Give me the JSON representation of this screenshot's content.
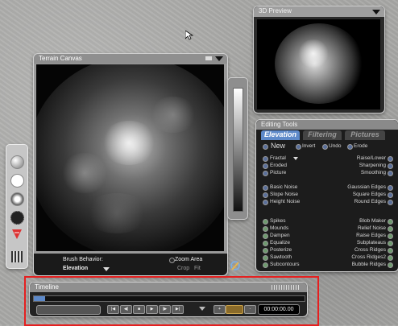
{
  "preview": {
    "title": "3D Preview"
  },
  "canvas": {
    "title": "Terrain Canvas",
    "brush_behavior_label": "Brush Behavior:",
    "brush_behavior_value": "Elevation",
    "zoom_area": "Zoom Area",
    "crop": "Crop",
    "fit": "Fit"
  },
  "editing": {
    "title": "Editing Tools",
    "tabs": [
      {
        "label": "Elevation",
        "active": true
      },
      {
        "label": "Filtering",
        "active": false
      },
      {
        "label": "Pictures",
        "active": false
      }
    ],
    "top_row": {
      "new": "New",
      "invert": "Invert",
      "undo": "Undo",
      "erode": "Erode"
    },
    "left_group_1": [
      "Fractal",
      "Eroded",
      "Picture"
    ],
    "right_group_1": [
      "Raise/Lower",
      "Sharpening",
      "Smoothing"
    ],
    "left_group_2": [
      "Basic Noise",
      "Slope Noise",
      "Height Noise"
    ],
    "right_group_2": [
      "Gaussian Edges",
      "Square Edges",
      "Round Edges"
    ],
    "left_group_3": [
      "Spikes",
      "Mounds",
      "Dampen",
      "Equalize",
      "Posterize",
      "Sawtooth",
      "Subcontours"
    ],
    "right_group_3": [
      "Blob Maker",
      "Relief Noise",
      "Raise Edges",
      "Subplateaus",
      "Cross Ridges",
      "Cross Ridges2",
      "Bubble Ridges"
    ]
  },
  "timeline": {
    "title": "Timeline",
    "time": "00:00:00.00"
  },
  "colors": {
    "background": "#a9a9a7",
    "panel": "#1b1b1b",
    "highlight": "#e52020",
    "tab_active": "#5d89c9"
  }
}
